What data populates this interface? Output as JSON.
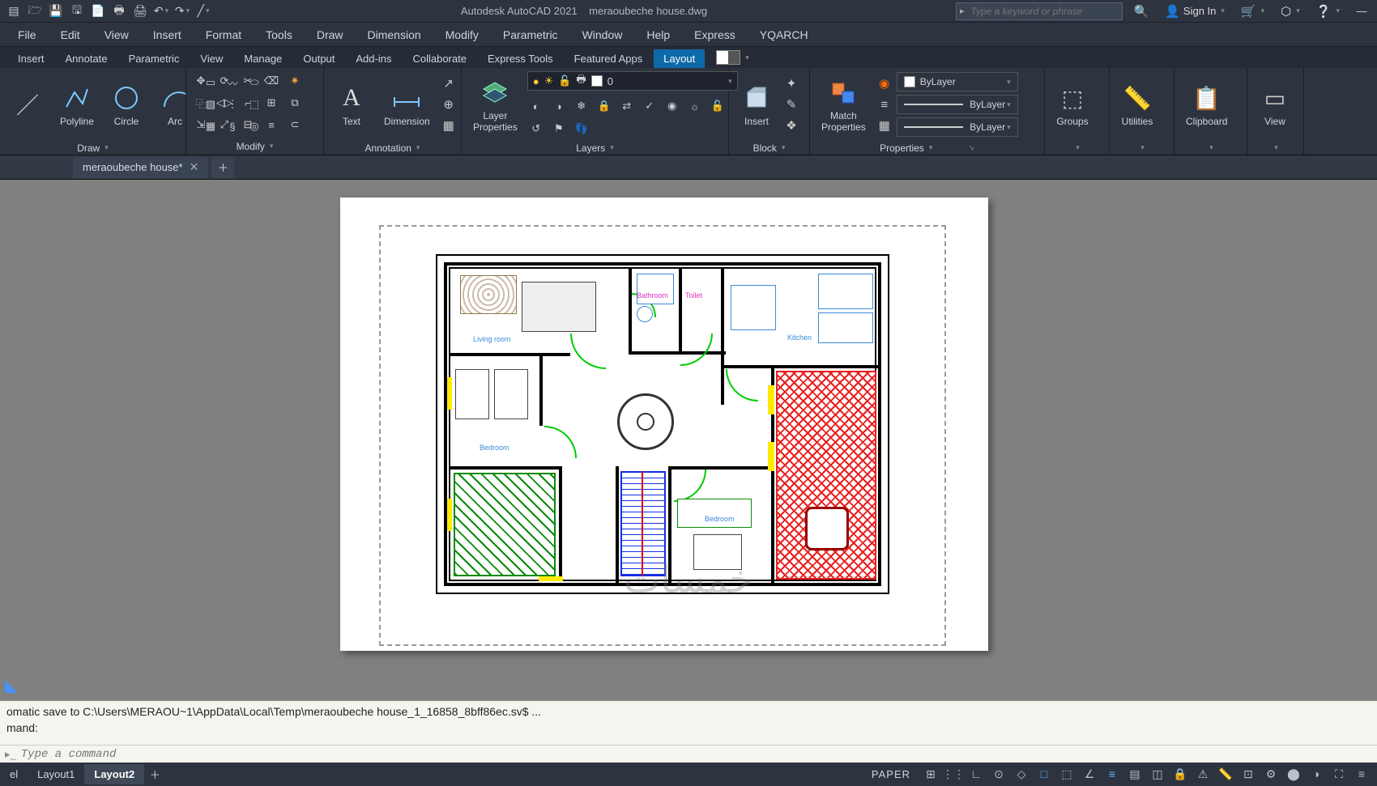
{
  "app": {
    "name": "Autodesk AutoCAD 2021",
    "file": "meraoubeche house.dwg"
  },
  "search": {
    "placeholder": "Type a keyword or phrase"
  },
  "signin": "Sign In",
  "menu": [
    "File",
    "Edit",
    "View",
    "Insert",
    "Format",
    "Tools",
    "Draw",
    "Dimension",
    "Modify",
    "Parametric",
    "Window",
    "Help",
    "Express",
    "YQARCH"
  ],
  "ribbontabs": [
    "Insert",
    "Annotate",
    "Parametric",
    "View",
    "Manage",
    "Output",
    "Add-ins",
    "Collaborate",
    "Express Tools",
    "Featured Apps",
    "Layout"
  ],
  "ribbontab_active": "Layout",
  "panels": {
    "draw": {
      "title": "Draw",
      "polyline": "Polyline",
      "circle": "Circle",
      "arc": "Arc"
    },
    "modify": {
      "title": "Modify"
    },
    "annotation": {
      "title": "Annotation",
      "text": "Text",
      "dimension": "Dimension"
    },
    "layers": {
      "title": "Layers",
      "props": "Layer\nProperties",
      "current": "0"
    },
    "block": {
      "title": "Block",
      "insert": "Insert"
    },
    "properties": {
      "title": "Properties",
      "match": "Match\nProperties",
      "bylayer": "ByLayer"
    },
    "groups": "Groups",
    "utilities": "Utilities",
    "clipboard": "Clipboard",
    "view": "View"
  },
  "doctab": "meraoubeche house*",
  "rooms": {
    "living": "Living room",
    "bedroom": "Bedroom",
    "kitchen": "Kitchen",
    "bathroom": "Bathroom",
    "toilet": "Toilet",
    "bedroom2": "Bedroom"
  },
  "cmd": {
    "line1": "omatic save to C:\\Users\\MERAOU~1\\AppData\\Local\\Temp\\meraoubeche house_1_16858_8bff86ec.sv$ ...",
    "line2": "mand:",
    "placeholder": "Type a command"
  },
  "layouts": [
    "el",
    "Layout1",
    "Layout2"
  ],
  "layout_active": "Layout2",
  "status": {
    "space": "PAPER"
  },
  "watermark": "خمسات"
}
